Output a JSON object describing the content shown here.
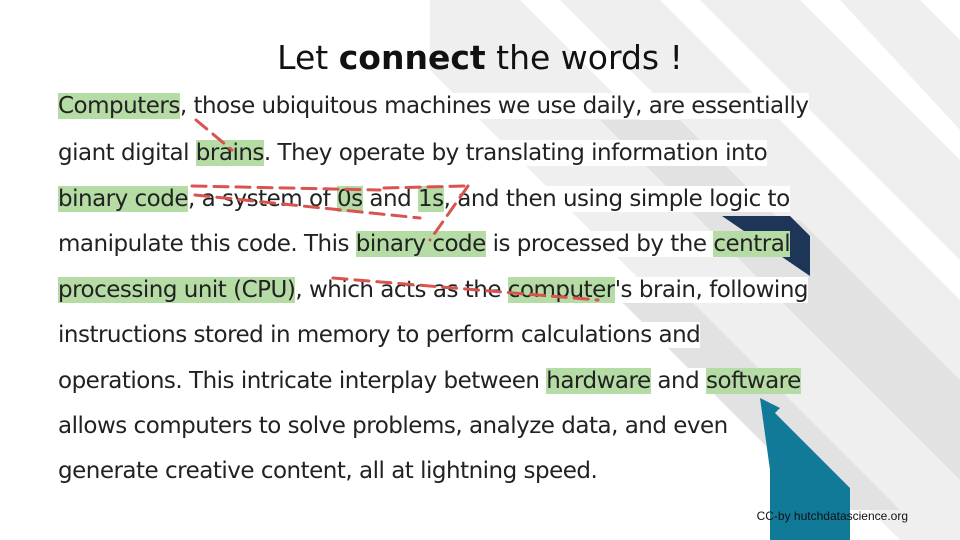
{
  "title": {
    "prefix": "Let ",
    "bold": "connect",
    "suffix": " the words !"
  },
  "paragraph": {
    "lines": [
      [
        {
          "t": "Computers",
          "hl": true
        },
        {
          "t": ", those ubiquitous machines we use daily, are essentially",
          "hl": false
        }
      ],
      [
        {
          "t": "giant digital ",
          "hl": false
        },
        {
          "t": "brains",
          "hl": true
        },
        {
          "t": ". They operate by translating information into",
          "hl": false
        }
      ],
      [
        {
          "t": "binary code",
          "hl": true
        },
        {
          "t": ", a system of ",
          "hl": false
        },
        {
          "t": "0s",
          "hl": true
        },
        {
          "t": " and ",
          "hl": false
        },
        {
          "t": "1s",
          "hl": true
        },
        {
          "t": ", and then using simple logic to",
          "hl": false
        }
      ],
      [
        {
          "t": "manipulate this code. This ",
          "hl": false
        },
        {
          "t": "binary code",
          "hl": true
        },
        {
          "t": " is processed by the ",
          "hl": false
        },
        {
          "t": "central",
          "hl": true
        }
      ],
      [
        {
          "t": "processing unit (CPU)",
          "hl": true
        },
        {
          "t": ", which acts as the ",
          "hl": false
        },
        {
          "t": "computer",
          "hl": true
        },
        {
          "t": "'s brain, following",
          "hl": false
        }
      ],
      [
        {
          "t": "instructions stored in memory to perform calculations and",
          "hl": false
        }
      ],
      [
        {
          "t": "operations. This intricate interplay between ",
          "hl": false
        },
        {
          "t": "hardware",
          "hl": true
        },
        {
          "t": " and ",
          "hl": false
        },
        {
          "t": "software",
          "hl": true
        }
      ],
      [
        {
          "t": "allows computers to solve problems, analyze data, and even",
          "hl": false
        }
      ],
      [
        {
          "t": "generate creative content, all at lightning speed.",
          "hl": false
        }
      ]
    ],
    "highlight_color": "#b6dca6"
  },
  "connector_color": "#d9534f",
  "credit": "CC-by hutchdatascience.org",
  "colors": {
    "navy": "#1d3557",
    "teal": "#117a99",
    "light_gray": "#e6e6e6"
  }
}
